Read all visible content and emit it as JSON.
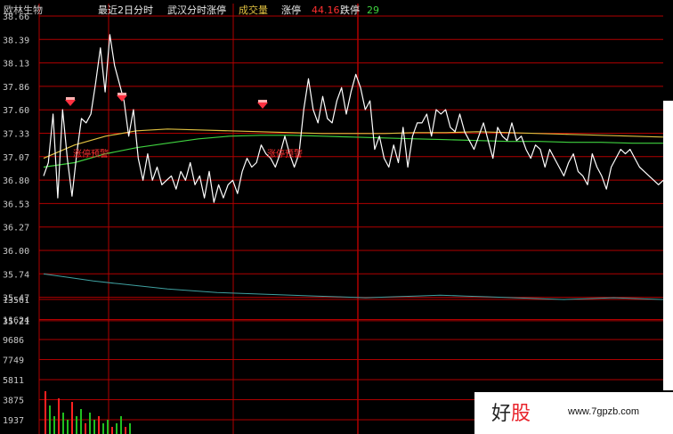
{
  "header": {
    "stock_name": "欧林生物",
    "period": "最近2日分时",
    "series_line": "武汉分时涨停",
    "volume_label": "成交量",
    "limit_up_label": "涨停",
    "limit_up_value": "44.16",
    "limit_down_label": "跌停",
    "limit_down_value": "29"
  },
  "colors": {
    "background": "#000000",
    "grid": "#b00000",
    "axis_text": "#c8c8c8",
    "price_line": "#ffffff",
    "avg_line_green": "#3fd23f",
    "avg_line_yellow": "#e0c040",
    "lower_line": "#3fa0a0",
    "annotation": "#ff3030",
    "volume_up": "#ff2020",
    "volume_down": "#20c020",
    "divider": "#b00000"
  },
  "annotations": [
    "涨停预警",
    "涨停预警",
    "涨停预警"
  ],
  "watermark": {
    "logo_main": "好",
    "logo_accent": "股",
    "url": "www.7gpzb.com"
  },
  "chart_data": {
    "type": "line",
    "title": "",
    "price_ticks": [
      "38.66",
      "38.39",
      "38.13",
      "37.86",
      "37.60",
      "37.33",
      "37.07",
      "36.80",
      "36.53",
      "36.27",
      "36.00",
      "35.74",
      "35.47",
      "35.21"
    ],
    "volume_ticks": [
      "13561",
      "11624",
      "9686",
      "7749",
      "5811",
      "3875",
      "1937"
    ],
    "ylim": [
      35.21,
      38.66
    ],
    "series": [
      {
        "values": [
          36.85,
          37.0,
          37.55,
          36.6,
          37.6,
          37.05,
          36.62,
          37.1,
          37.5,
          37.45,
          37.55,
          37.9,
          38.3,
          37.8,
          38.45,
          38.1,
          37.9,
          37.7,
          37.3,
          37.6,
          37.05,
          36.8,
          37.1,
          36.8,
          36.95,
          36.75,
          36.8,
          36.85,
          36.7,
          36.9,
          36.8,
          37.0,
          36.75,
          36.85,
          36.6,
          36.9,
          36.55,
          36.75,
          36.6,
          36.75,
          36.8,
          36.65,
          36.9,
          37.05,
          36.95,
          37.0,
          37.2,
          37.1,
          37.05,
          36.95,
          37.1,
          37.3,
          37.1,
          36.95,
          37.1,
          37.6,
          37.95,
          37.6,
          37.45,
          37.75,
          37.5,
          37.45,
          37.7,
          37.85,
          37.55,
          37.8,
          38.0,
          37.85,
          37.6,
          37.7,
          37.15,
          37.3,
          37.05,
          36.95,
          37.2,
          37.0,
          37.4,
          36.95,
          37.3,
          37.45,
          37.45,
          37.55,
          37.3,
          37.6,
          37.55,
          37.6,
          37.4,
          37.35,
          37.55,
          37.35,
          37.25,
          37.15,
          37.3,
          37.45,
          37.25,
          37.05,
          37.4,
          37.3,
          37.25,
          37.45,
          37.25,
          37.3,
          37.15,
          37.05,
          37.2,
          37.15,
          36.95,
          37.15,
          37.05,
          36.95,
          36.85,
          37.0,
          37.1,
          36.9,
          36.85,
          36.75,
          37.1,
          36.95,
          36.85,
          36.7,
          36.95,
          37.05,
          37.15,
          37.1,
          37.15,
          37.05,
          36.95,
          36.9,
          36.85,
          36.8,
          36.75,
          36.8
        ]
      },
      {
        "values": [
          36.95,
          37.0,
          37.1,
          37.17,
          37.22,
          37.27,
          37.3,
          37.31,
          37.31,
          37.3,
          37.29,
          37.28,
          37.27,
          37.26,
          37.25,
          37.24,
          37.24,
          37.23,
          37.23,
          37.22,
          37.22
        ]
      },
      {
        "values": [
          37.05,
          37.2,
          37.3,
          37.36,
          37.38,
          37.37,
          37.36,
          37.35,
          37.34,
          37.33,
          37.33,
          37.33,
          37.34,
          37.34,
          37.35,
          37.34,
          37.33,
          37.32,
          37.31,
          37.3,
          37.29
        ]
      },
      {
        "values": [
          35.74,
          35.7,
          35.66,
          35.63,
          35.6,
          35.57,
          35.55,
          35.53,
          35.52,
          35.51,
          35.5,
          35.49,
          35.48,
          35.47,
          35.48,
          35.49,
          35.5,
          35.49,
          35.48,
          35.47,
          35.46,
          35.45,
          35.46,
          35.47,
          35.46,
          35.45
        ]
      }
    ],
    "volume": [
      0.12,
      0.08,
      0.05,
      0.1,
      0.06,
      0.04,
      0.09,
      0.05,
      0.07,
      0.03,
      0.06,
      0.04,
      0.05,
      0.03,
      0.04,
      0.02,
      0.03,
      0.05,
      0.02,
      0.03
    ],
    "legend": "none",
    "grid": true
  }
}
